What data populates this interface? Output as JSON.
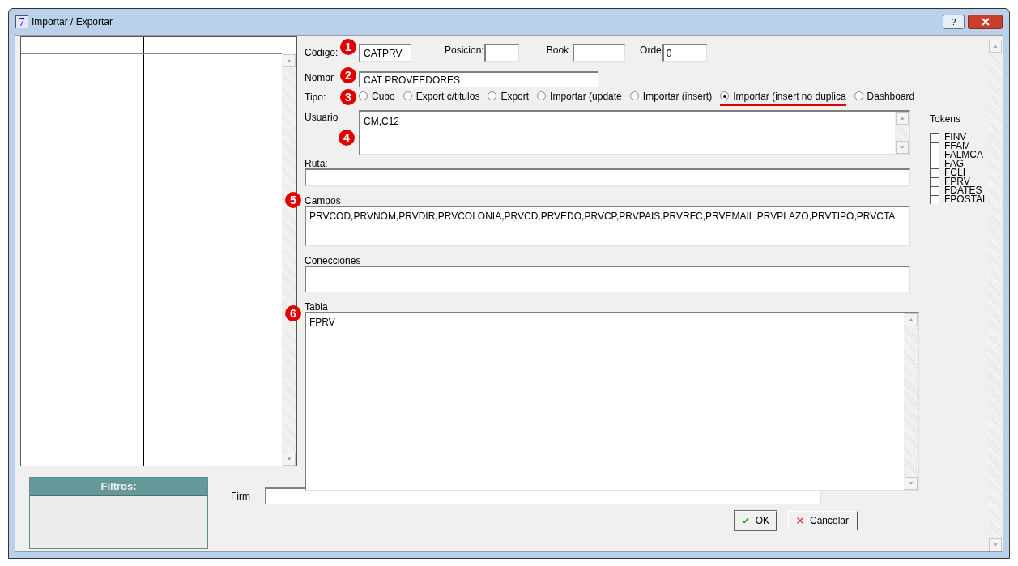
{
  "window": {
    "title": "Importar / Exportar",
    "app_icon": "7",
    "help_button": "?"
  },
  "form": {
    "codigo": {
      "label": "Código:",
      "value": "CATPRV",
      "marker": "1"
    },
    "posicion": {
      "label": "Posicion:"
    },
    "book": {
      "label": "Book"
    },
    "orde": {
      "label": "Orde",
      "value": "0"
    },
    "nombre": {
      "label": "Nombr",
      "value": "CAT PROVEEDORES",
      "marker": "2"
    },
    "tipo": {
      "label": "Tipo:",
      "marker": "3",
      "options": [
        {
          "label": "Cubo",
          "selected": false
        },
        {
          "label": "Export c/titulos",
          "selected": false
        },
        {
          "label": "Export",
          "selected": false
        },
        {
          "label": "Importar (update",
          "selected": false
        },
        {
          "label": "Importar (insert)",
          "selected": false
        },
        {
          "label": "Importar (insert no duplica",
          "selected": true
        },
        {
          "label": "Dashboard",
          "selected": false
        }
      ]
    },
    "usuario": {
      "label": "Usuario",
      "value": "CM,C12",
      "marker": "4"
    },
    "ruta": {
      "label": "Ruta:"
    },
    "campos": {
      "label": "Campos",
      "value": "PRVCOD,PRVNOM,PRVDIR,PRVCOLONIA,PRVCD,PRVEDO,PRVCP,PRVPAIS,PRVRFC,PRVEMAIL,PRVPLAZO,PRVTIPO,PRVCTA",
      "marker": "5"
    },
    "conecciones": {
      "label": "Conecciones"
    },
    "tabla": {
      "label": "Tabla",
      "value": "FPRV",
      "marker": "6"
    }
  },
  "tokens": {
    "title": "Tokens",
    "items": [
      {
        "label": "FINV",
        "checked": false
      },
      {
        "label": "FFAM",
        "checked": false
      },
      {
        "label": "FALMCA",
        "checked": false
      },
      {
        "label": "FAG",
        "checked": false
      },
      {
        "label": "FCLI",
        "checked": false
      },
      {
        "label": "FPRV",
        "checked": false
      },
      {
        "label": "FDATES",
        "checked": false
      },
      {
        "label": "FPOSTAL",
        "checked": false
      }
    ]
  },
  "filtros": {
    "title": "Filtros:"
  },
  "firm": {
    "label": "Firm"
  },
  "buttons": [
    {
      "label": "OK",
      "kind": "ok"
    },
    {
      "label": "Cancelar",
      "kind": "cancel"
    }
  ]
}
